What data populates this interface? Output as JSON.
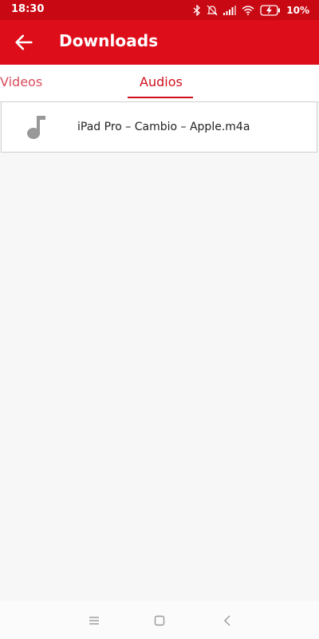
{
  "status": {
    "time": "18:30",
    "battery": "10%"
  },
  "appbar": {
    "title": "Downloads",
    "back_icon": "arrow-back-icon"
  },
  "tabs": [
    {
      "label": "Videos",
      "selected": false
    },
    {
      "label": "Audios",
      "selected": true
    }
  ],
  "downloads": [
    {
      "icon": "music-note-icon",
      "name": "iPad Pro – Cambio – Apple.m4a"
    }
  ],
  "navbar": {
    "items": [
      "menu-icon",
      "home-icon",
      "back-icon"
    ]
  },
  "colors": {
    "primary": "#dd0d1a",
    "statusbar": "#c80812",
    "accent": "#d0101d"
  }
}
